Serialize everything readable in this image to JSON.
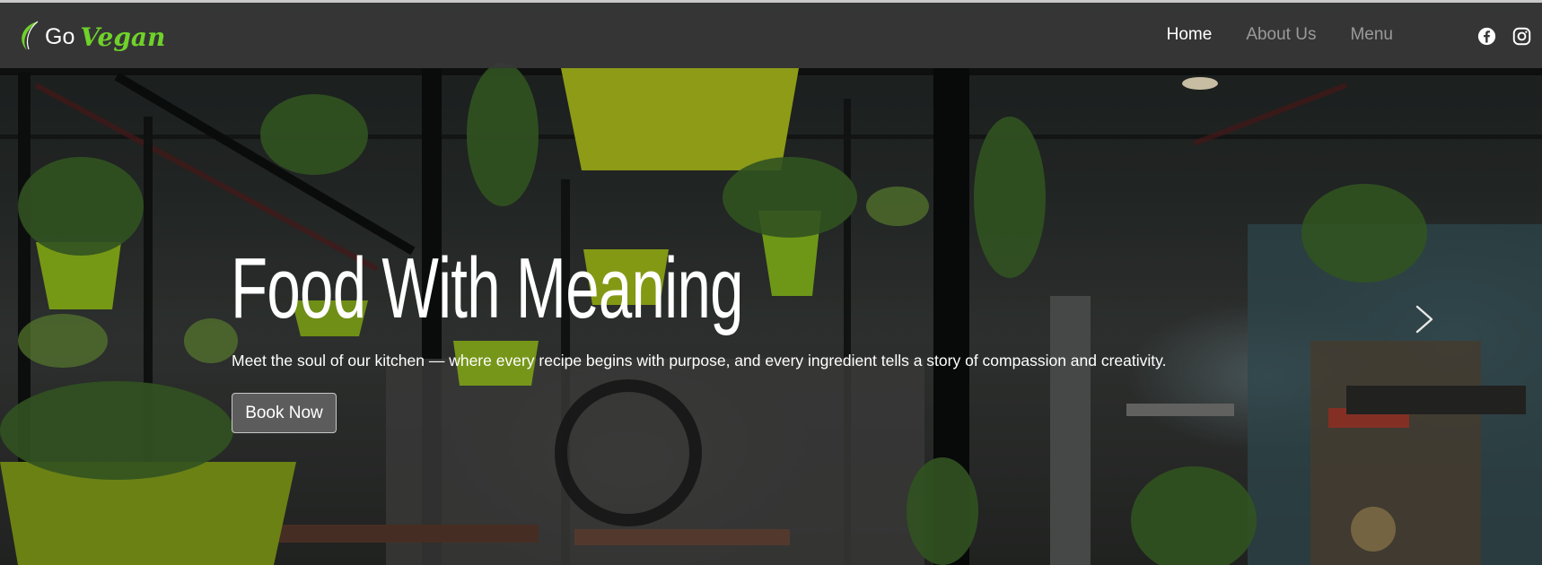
{
  "brand": {
    "go": "Go",
    "vegan": "Vegan",
    "accent": "#6fd12a"
  },
  "nav": {
    "items": [
      {
        "label": "Home",
        "active": true
      },
      {
        "label": "About Us",
        "active": false
      },
      {
        "label": "Menu",
        "active": false
      }
    ],
    "social": [
      "facebook-icon",
      "instagram-icon"
    ]
  },
  "hero": {
    "title": "Food With Meaning",
    "subtitle": "Meet the soul of our kitchen — where every recipe begins with purpose, and every ingredient tells a story of compassion and creativity.",
    "cta": "Book Now",
    "next_icon": "chevron-right-icon"
  }
}
